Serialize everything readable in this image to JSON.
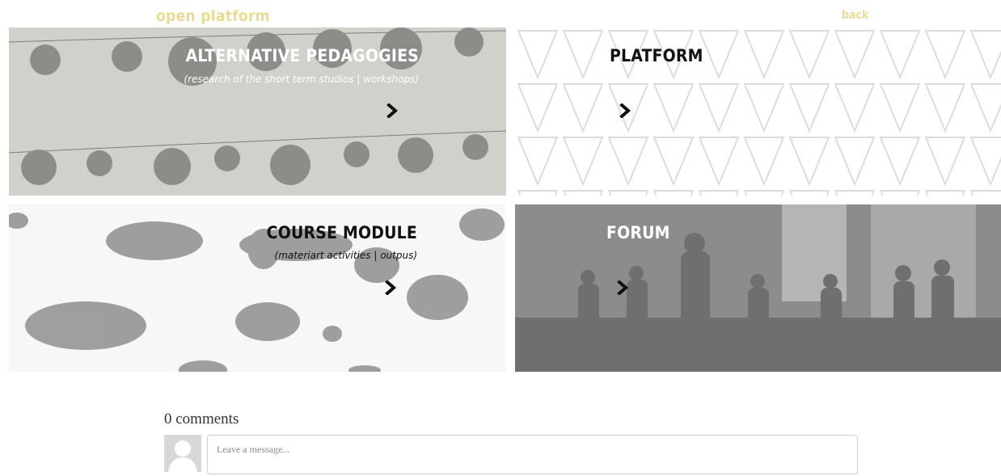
{
  "header": {
    "brand": "open platform",
    "back_label": "back"
  },
  "tiles": [
    {
      "title": "ALTERNATIVE PEDAGOGIES",
      "subtitle": "(research of the short term studios | workshops)"
    },
    {
      "title": "PLATFORM"
    },
    {
      "title": "COURSE MODULE",
      "subtitle": "(materiart activities | outpus)"
    },
    {
      "title": "FORUM"
    }
  ],
  "comments": {
    "title": "0 comments",
    "placeholder": "Leave a message..."
  },
  "colors": {
    "accent": "#e9dc92",
    "title_light": "#ffffff",
    "title_dark": "#111111"
  },
  "icons": {
    "tile_arrow": "chevron-right-icon",
    "avatar": "user-avatar-icon"
  }
}
